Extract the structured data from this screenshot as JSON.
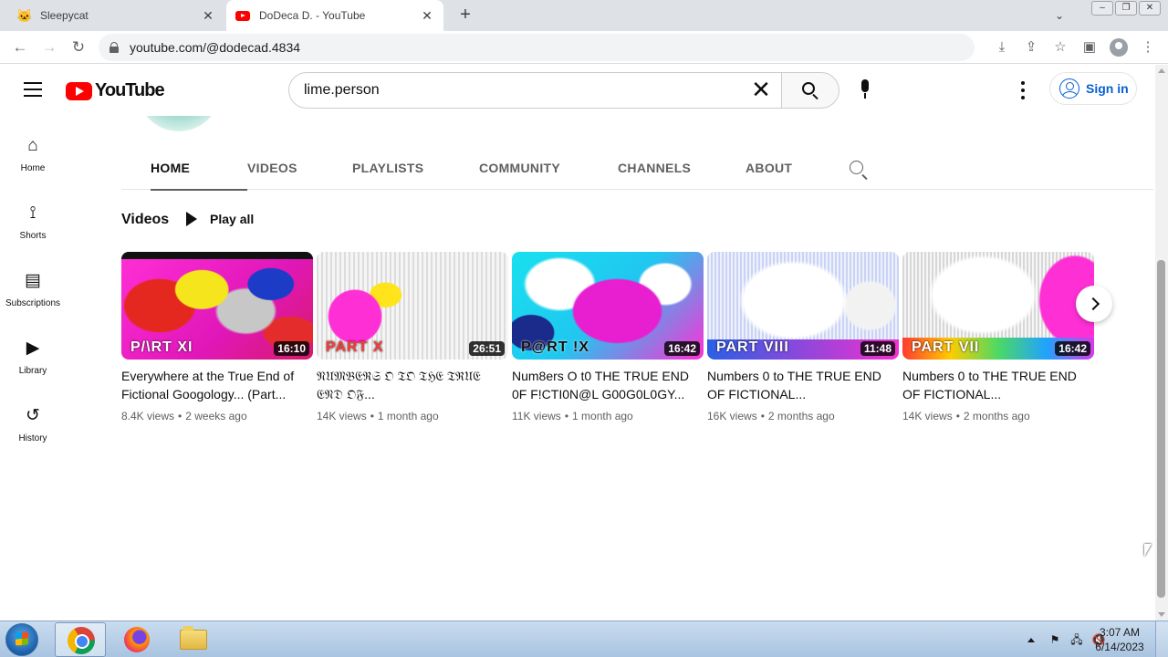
{
  "browser": {
    "tabs": [
      {
        "title": "Sleepycat",
        "favicon": "cat-icon",
        "active": false
      },
      {
        "title": "DoDeca D. - YouTube",
        "favicon": "youtube-icon",
        "active": true
      }
    ],
    "address": "youtube.com/@dodecad.4834"
  },
  "youtube": {
    "logo_text": "YouTube",
    "search_query": "lime.person",
    "signin_label": "Sign in",
    "guide": [
      {
        "label": "Home",
        "icon": "home-icon"
      },
      {
        "label": "Shorts",
        "icon": "shorts-icon"
      },
      {
        "label": "Subscriptions",
        "icon": "subscriptions-icon"
      },
      {
        "label": "Library",
        "icon": "library-icon"
      },
      {
        "label": "History",
        "icon": "history-icon"
      }
    ],
    "channel_tabs": [
      "HOME",
      "VIDEOS",
      "PLAYLISTS",
      "COMMUNITY",
      "CHANNELS",
      "ABOUT"
    ],
    "active_tab": "HOME",
    "section_title": "Videos",
    "play_all_label": "Play all",
    "videos": [
      {
        "title": "Everywhere at the True End of Fictional Googology... (Part...",
        "duration": "16:10",
        "views": "8.4K views",
        "age": "2 weeks ago",
        "thumb_text": "P/\\RT XI"
      },
      {
        "title": "𝔑𝔘𝔐𝔅𝔈ℜ𝔖 𝔒 𝔗𝔒 𝔗ℌ𝔈 𝔗ℜ𝔘𝔈 𝔈𝔑𝔇 𝔒𝔉...",
        "duration": "26:51",
        "views": "14K views",
        "age": "1 month ago",
        "thumb_text": "PART X"
      },
      {
        "title": "Num8ers O t0 THE TRUE END 0F F!CTI0N@L G00G0L0GY...",
        "duration": "16:42",
        "views": "11K views",
        "age": "1 month ago",
        "thumb_text": "P@RT !X"
      },
      {
        "title": "Numbers 0 to THE TRUE END OF FICTIONAL...",
        "duration": "11:48",
        "views": "16K views",
        "age": "2 months ago",
        "thumb_text": "PART VIII"
      },
      {
        "title": "Numbers 0 to THE TRUE END OF FICTIONAL...",
        "duration": "16:42",
        "views": "14K views",
        "age": "2 months ago",
        "thumb_text": "PART VII"
      }
    ]
  },
  "taskbar": {
    "time": "3:07 AM",
    "date": "6/14/2023"
  },
  "colors": {
    "accent_blue": "#065fd4",
    "yt_red": "#ff0000"
  }
}
